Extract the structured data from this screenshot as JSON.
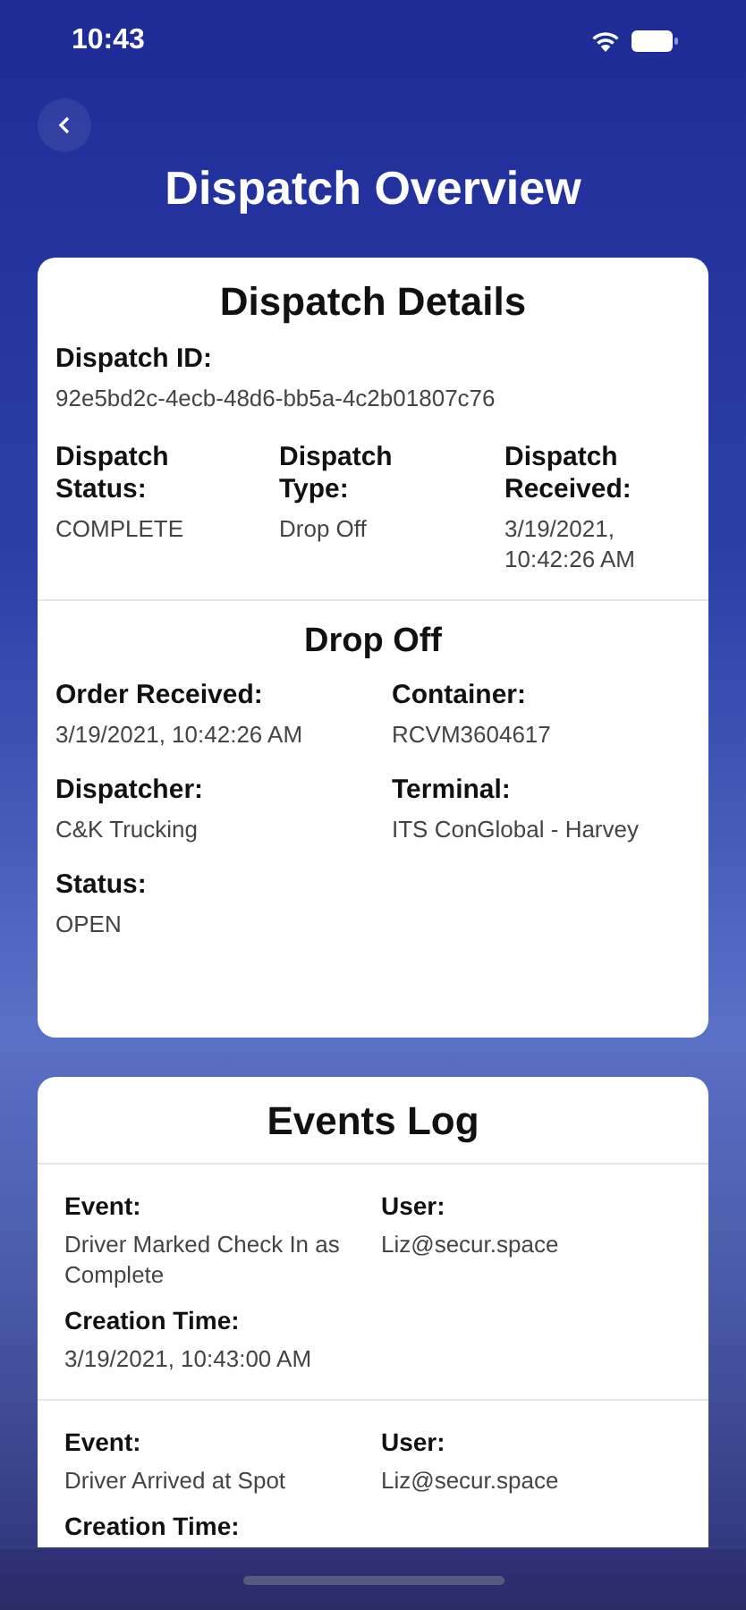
{
  "status_bar": {
    "time": "10:43"
  },
  "title": "Dispatch Overview",
  "details": {
    "title": "Dispatch Details",
    "id_field": {
      "label": "Dispatch ID:",
      "value": "92e5bd2c-4ecb-48d6-bb5a-4c2b01807c76"
    },
    "fields": [
      {
        "label": "Dispatch Status:",
        "value": "COMPLETE"
      },
      {
        "label": "Dispatch Type:",
        "value": "Drop Off"
      },
      {
        "label": "Dispatch Received:",
        "value": "3/19/2021, 10:42:26 AM"
      }
    ]
  },
  "drop_off": {
    "title": "Drop Off",
    "fields": [
      {
        "label": "Order Received:",
        "value": "3/19/2021, 10:42:26 AM"
      },
      {
        "label": "Container:",
        "value": "RCVM3604617"
      },
      {
        "label": "Dispatcher:",
        "value": "C&K Trucking"
      },
      {
        "label": "Terminal:",
        "value": "ITS ConGlobal - Harvey"
      },
      {
        "label": "Status:",
        "value": "OPEN"
      }
    ]
  },
  "events_log": {
    "title": "Events Log",
    "events": [
      {
        "fields": [
          {
            "label": "Event:",
            "value": "Driver Marked Check In as Complete"
          },
          {
            "label": "User:",
            "value": "Liz@secur.space"
          },
          {
            "label": "Creation Time:",
            "value": "3/19/2021, 10:43:00 AM"
          }
        ]
      },
      {
        "fields": [
          {
            "label": "Event:",
            "value": "Driver Arrived at Spot"
          },
          {
            "label": "User:",
            "value": "Liz@secur.space"
          },
          {
            "label": "Creation Time:"
          }
        ]
      }
    ]
  }
}
